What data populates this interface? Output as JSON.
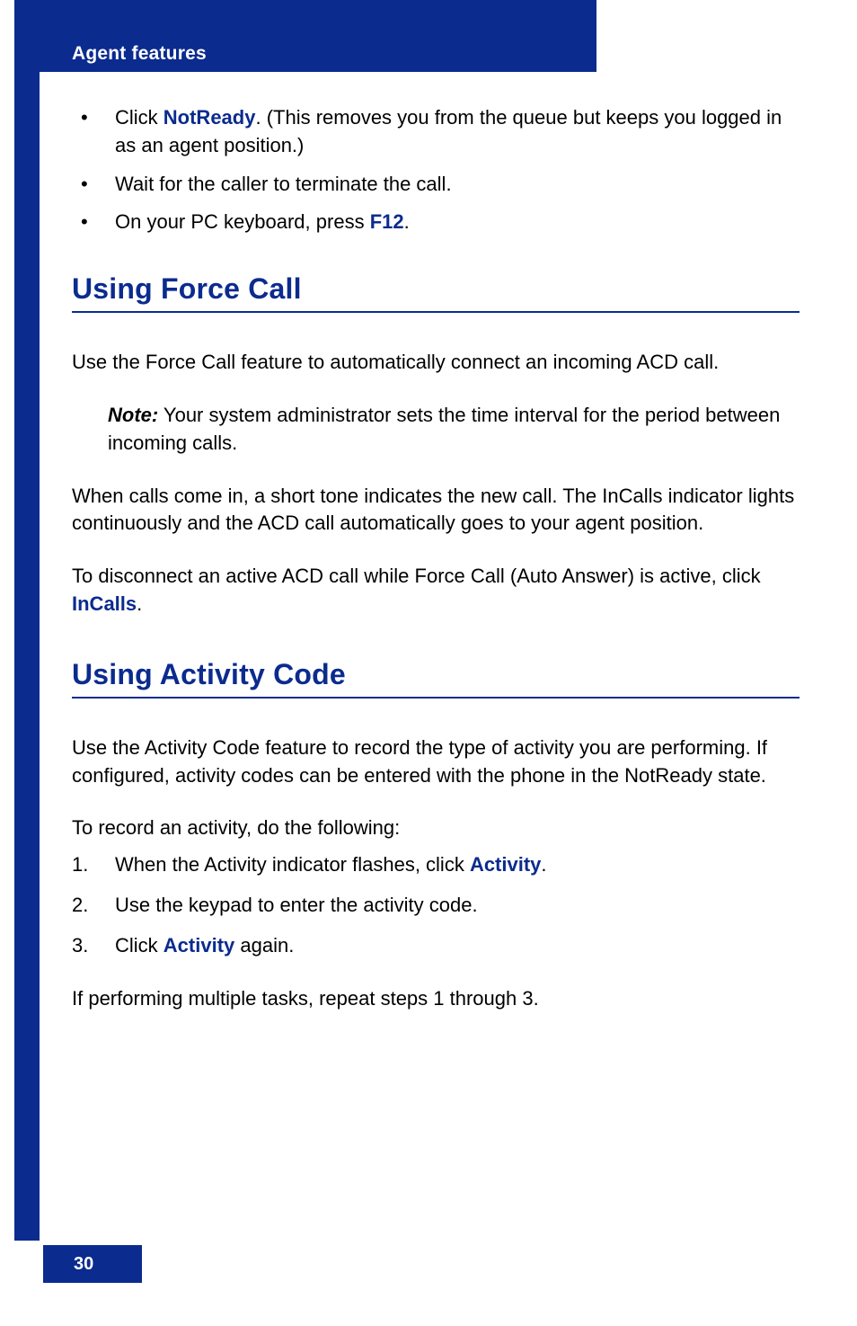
{
  "header": {
    "title": "Agent features"
  },
  "bullets": {
    "b1_prefix": "Click ",
    "b1_link": "NotReady",
    "b1_suffix": ". (This removes you from the queue but keeps you logged in as an agent position.)",
    "b2": "Wait for the caller to terminate the call.",
    "b3_prefix": "On your PC keyboard, press ",
    "b3_link": "F12",
    "b3_suffix": "."
  },
  "section1": {
    "heading": "Using Force Call",
    "p1": "Use the Force Call feature to automatically connect an incoming ACD call.",
    "note_label": "Note:",
    "note_text": " Your system administrator sets the time interval for the period between incoming calls.",
    "p2": "When calls come in, a short tone indicates the new call. The InCalls indicator lights continuously and the ACD call automatically goes to your agent position.",
    "p3_prefix": "To disconnect an active ACD call while Force Call (Auto Answer) is active, click ",
    "p3_link": "InCalls",
    "p3_suffix": "."
  },
  "section2": {
    "heading": "Using Activity Code",
    "p1": "Use the Activity Code feature to record the type of activity you are performing. If configured, activity codes can be entered with the phone in the NotReady state.",
    "p2": "To record an activity, do the following:",
    "steps": {
      "n1": "1.",
      "s1_prefix": "When the Activity indicator flashes, click ",
      "s1_link": "Activity",
      "s1_suffix": ".",
      "n2": "2.",
      "s2": "Use the keypad to enter the activity code.",
      "n3": "3.",
      "s3_prefix": "Click ",
      "s3_link": "Activity",
      "s3_suffix": " again."
    },
    "p3": "If performing multiple tasks, repeat steps 1 through 3."
  },
  "page_number": "30"
}
